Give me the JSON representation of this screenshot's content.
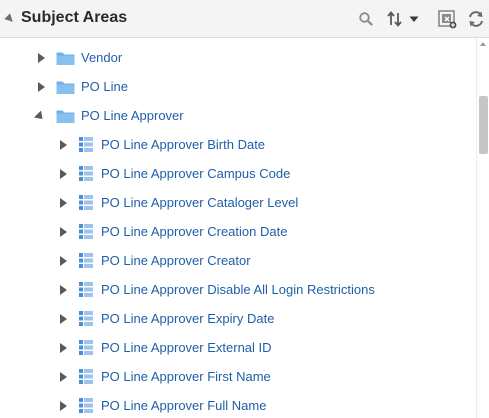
{
  "panel": {
    "title": "Subject Areas"
  },
  "toolbar": {
    "search_icon": "search-icon",
    "sort_icon": "sort-icon",
    "menu_icon": "chevron-down-icon",
    "view_icon": "expand-view-icon",
    "refresh_icon": "refresh-icon"
  },
  "tree": {
    "folders": [
      {
        "label": "Vendor",
        "expanded": false
      },
      {
        "label": "PO Line",
        "expanded": false
      },
      {
        "label": "PO Line Approver",
        "expanded": true
      }
    ],
    "columns": [
      {
        "label": "PO Line Approver Birth Date"
      },
      {
        "label": "PO Line Approver Campus Code"
      },
      {
        "label": "PO Line Approver Cataloger Level"
      },
      {
        "label": "PO Line Approver Creation Date"
      },
      {
        "label": "PO Line Approver Creator"
      },
      {
        "label": "PO Line Approver Disable All Login Restrictions"
      },
      {
        "label": "PO Line Approver Expiry Date"
      },
      {
        "label": "PO Line Approver External ID"
      },
      {
        "label": "PO Line Approver First Name"
      },
      {
        "label": "PO Line Approver Full Name"
      }
    ]
  },
  "colors": {
    "link": "#1f5fa8",
    "folder": "#6fb1e8",
    "column_icon": "#4a90d9",
    "header_bg": "#f4f4f4"
  }
}
